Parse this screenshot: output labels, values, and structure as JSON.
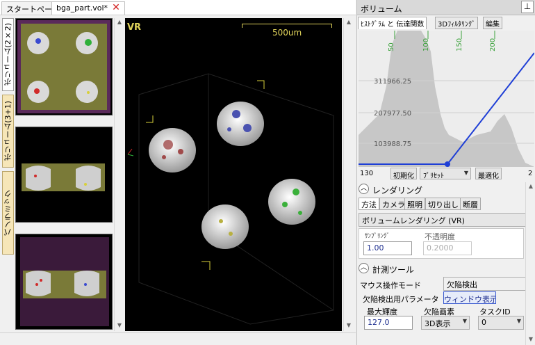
{
  "doc_tabs": [
    {
      "label": "スタートページ"
    },
    {
      "label": "bga_part.vol*"
    }
  ],
  "left_tabs": [
    {
      "label": "ボリューム(2×2)"
    },
    {
      "label": "ボリューム(3+1)"
    },
    {
      "label": "パノラミック"
    }
  ],
  "viewport": {
    "mode": "VR",
    "scale_label": "500um"
  },
  "panel": {
    "title": "ボリューム",
    "tabs": [
      {
        "label": "ﾋｽﾄｸﾞﾗﾑ と 伝達関数"
      },
      {
        "label": "3Dﾌｨﾙﾀﾘﾝｸﾞ"
      },
      {
        "label": "編集"
      }
    ],
    "histogram": {
      "x_ticks": [
        "50",
        "100",
        "150",
        "200"
      ],
      "y_ticks": [
        "311966.25",
        "207977.50",
        "103988.75"
      ],
      "range_min": "130",
      "range_max": "2",
      "buttons": {
        "init": "初期化",
        "preset": "ﾌﾟﾘｾｯﾄ",
        "optimize": "最適化"
      }
    },
    "rendering": {
      "header": "レンダリング",
      "tabs": [
        {
          "label": "方法"
        },
        {
          "label": "カメラ"
        },
        {
          "label": "照明"
        },
        {
          "label": "切り出し"
        },
        {
          "label": "断層"
        }
      ],
      "method": "ボリュームレンダリング (VR)",
      "sampling_label": "ｻﾝﾌﾟﾘﾝｸﾞ",
      "sampling_value": "1.00",
      "opacity_label": "不透明度",
      "opacity_value": "0.2000"
    },
    "measure": {
      "header": "計測ツール",
      "mouse_mode_label": "マウス操作モード",
      "mouse_mode_value": "欠陥検出",
      "defect_param_label": "欠陥検出用パラメータ",
      "window_button": "ウィンドウ表示",
      "max_brightness_label": "最大輝度",
      "max_brightness_value": "127.0",
      "defect_pixel_label": "欠陥画素",
      "defect_pixel_value": "3D表示",
      "task_id_label": "タスクID",
      "task_id_value": "0"
    }
  },
  "colors": {
    "histogram_fill": "#c7c7c7",
    "histogram_bg": "#ededed",
    "transfer_line": "#1f3fd6",
    "tick_green": "#3aa13a",
    "tab_yellow": "#f6e6b8",
    "viewport_bg": "#000000",
    "thumb_board": "#7a7a38",
    "scale_yellow": "#e0d35a"
  }
}
